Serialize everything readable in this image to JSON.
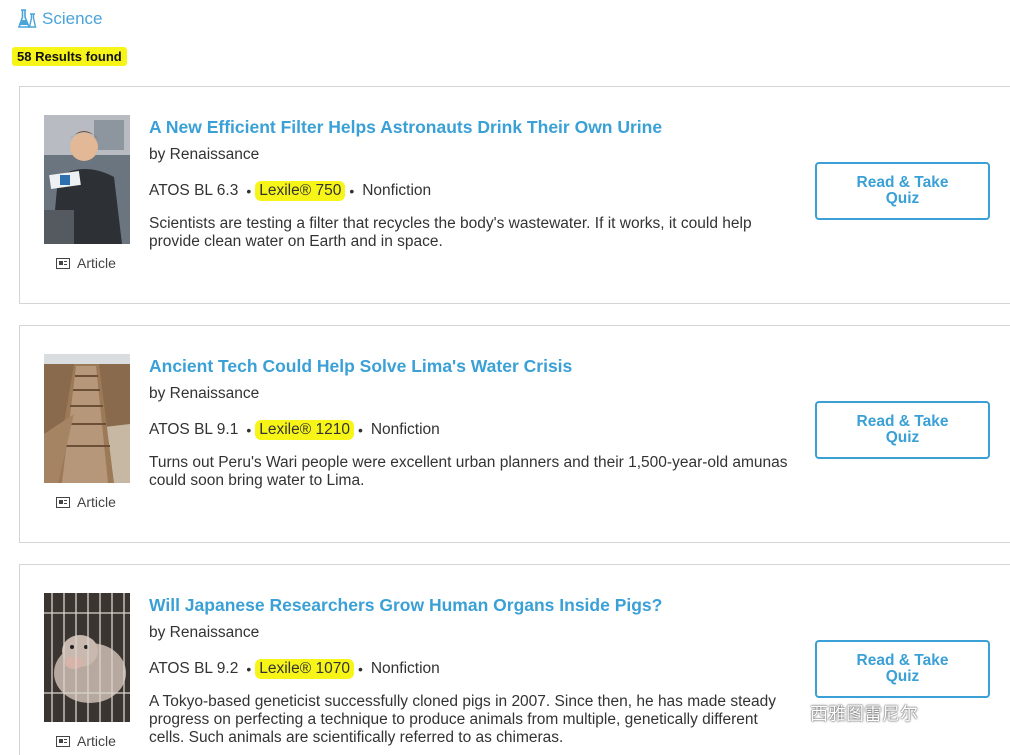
{
  "header": {
    "category": "Science",
    "icon": "flask-icon",
    "results_count": "58 Results found"
  },
  "articles": [
    {
      "title": "A New Efficient Filter Helps Astronauts Drink Their Own Urine",
      "author": "by Renaissance",
      "atos": "ATOS BL 6.3",
      "lexile": "Lexile® 750",
      "genre": "Nonfiction",
      "description": "Scientists are testing a filter that recycles the body's wastewater. If it works, it could help provide clean water on Earth and in space.",
      "type": "Article",
      "button": "Read & Take Quiz",
      "thumbnail": "astronaut-photo"
    },
    {
      "title": "Ancient Tech Could Help Solve Lima's Water Crisis",
      "author": "by Renaissance",
      "atos": "ATOS BL 9.1",
      "lexile": "Lexile® 1210",
      "genre": "Nonfiction",
      "description": "Turns out Peru's Wari people were excellent urban planners and their 1,500-year-old amunas could soon bring water to Lima.",
      "type": "Article",
      "button": "Read & Take Quiz",
      "thumbnail": "ancient-terraces-photo"
    },
    {
      "title": "Will Japanese Researchers Grow Human Organs Inside Pigs?",
      "author": "by Renaissance",
      "atos": "ATOS BL 9.2",
      "lexile": "Lexile® 1070",
      "genre": "Nonfiction",
      "description": "A Tokyo-based geneticist successfully cloned pigs in 2007. Since then, he has made steady progress on perfecting a technique to produce animals from multiple, genetically different cells. Such animals are scientifically referred to as chimeras.",
      "type": "Article",
      "button": "Read & Take Quiz",
      "thumbnail": "pig-in-cage-photo"
    }
  ],
  "watermark": {
    "text": "西雅图雷尼尔",
    "icon": "wechat-icon"
  },
  "colors": {
    "link": "#3aa0d6",
    "highlight": "#f7f518",
    "border": "#d5d5d5"
  }
}
